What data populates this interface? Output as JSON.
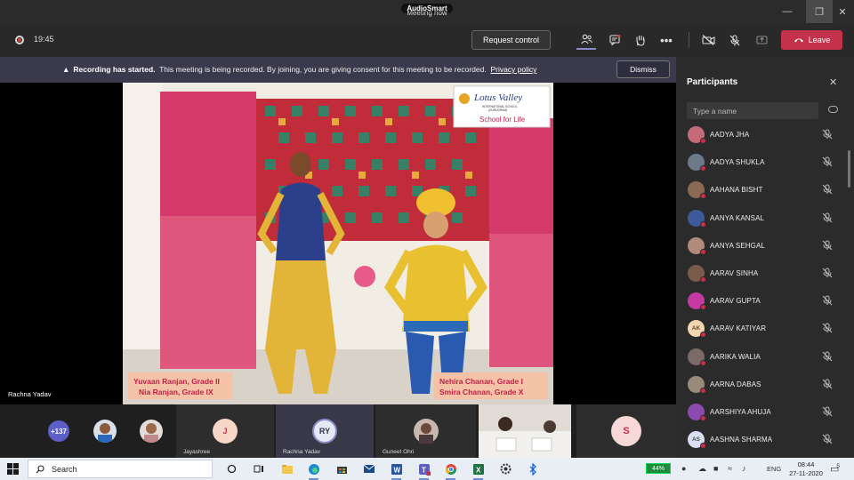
{
  "window": {
    "title": "Meeting now",
    "app_badge": "AudioSmart"
  },
  "toolbar": {
    "timer": "19:45",
    "request_control_label": "Request control",
    "leave_label": "Leave",
    "icons": [
      "participants-icon",
      "chat-icon",
      "raise-hand-icon",
      "more-icon",
      "camera-off-icon",
      "mic-off-icon",
      "share-icon"
    ]
  },
  "banner": {
    "bold": "Recording has started.",
    "text": "This meeting is being recorded. By joining, you are giving consent for this meeting to be recorded.",
    "link": "Privacy policy",
    "dismiss_label": "Dismiss"
  },
  "stage": {
    "speaker_name": "Rachna Yadav",
    "logo_title": "Lotus Valley",
    "logo_sub1": "INTERNATIONAL SCHOOL",
    "logo_sub2": "(GURUGRAM)",
    "logo_tagline": "School for Life",
    "caption_left_1": "Yuvaan Ranjan, Grade II",
    "caption_left_2": "Nia Ranjan, Grade IX",
    "caption_right_1": "Nehira Chanan, Grade I",
    "caption_right_2": "Smira Chanan, Grade X"
  },
  "strip": {
    "overflow_count": "+137",
    "tiles": [
      {
        "initials": "J",
        "name": "Jayashree"
      },
      {
        "initials": "RY",
        "name": "Rachna Yadav"
      },
      {
        "initials": "",
        "name": "Guneet Ohri"
      },
      {
        "initials": "S",
        "name": ""
      }
    ]
  },
  "participants": {
    "title": "Participants",
    "search_placeholder": "Type a name",
    "list": [
      {
        "name": "AADYA JHA",
        "initials": "",
        "color": "#c46b7a"
      },
      {
        "name": "AADYA SHUKLA",
        "initials": "",
        "color": "#6c7a8a"
      },
      {
        "name": "AAHANA BISHT",
        "initials": "",
        "color": "#8a6a55"
      },
      {
        "name": "AANYA KANSAL",
        "initials": "",
        "color": "#3b5b9a"
      },
      {
        "name": "AANYA SEHGAL",
        "initials": "",
        "color": "#b08a7a"
      },
      {
        "name": "AARAV SINHA",
        "initials": "",
        "color": "#7a5a4a"
      },
      {
        "name": "AARAV GUPTA",
        "initials": "",
        "color": "#c43aa0"
      },
      {
        "name": "AARAV KATIYAR",
        "initials": "AK",
        "color": "#f3d6b0"
      },
      {
        "name": "AARIKA WALIA",
        "initials": "",
        "color": "#7a6a6a"
      },
      {
        "name": "AARNA DABAS",
        "initials": "",
        "color": "#9a8a7a"
      },
      {
        "name": "AARSHIYA AHUJA",
        "initials": "",
        "color": "#8a4ab0"
      },
      {
        "name": "AASHNA SHARMA",
        "initials": "AS",
        "color": "#d8dff0"
      }
    ]
  },
  "taskbar": {
    "search_label": "Search",
    "battery": "44%",
    "lang": "ENG",
    "time": "08:44",
    "date": "27-11-2020",
    "notification_count": "5"
  }
}
